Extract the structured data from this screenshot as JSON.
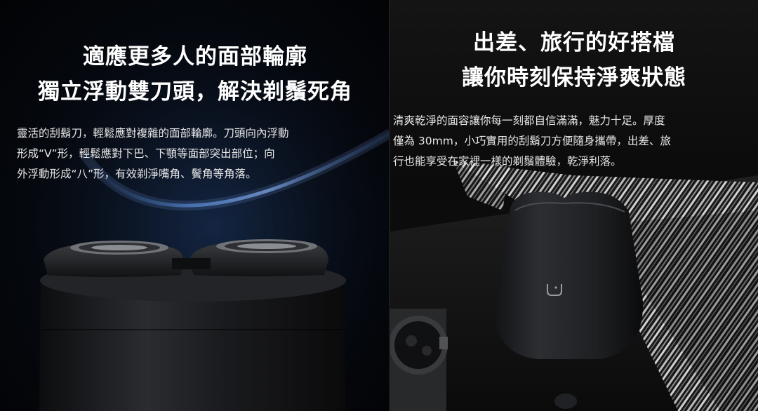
{
  "left": {
    "title_line1": "適應更多人的面部輪廓",
    "title_line2": "獨立浮動雙刀頭，解決剃鬚死角",
    "body_line1": "靈活的刮鬍刀，輕鬆應對複雜的面部輪廓。刀頭向內浮動",
    "body_line2": "形成“V”形，輕鬆應對下巴、下顎等面部突出部位；向",
    "body_line3": "外浮動形成“八”形，有效剃淨嘴角、鬢角等角落。"
  },
  "right": {
    "title_line1": "出差、旅行的好搭檔",
    "title_line2": "讓你時刻保持淨爽狀態",
    "body_line1": "清爽乾淨的面容讓你每一刻都自信滿滿，魅力十足。厚度",
    "body_line2": "僅為 30mm，小巧實用的刮鬍刀方便隨身攜帶，出差、旅",
    "body_line3": "行也能享受在家裡一樣的剃鬚體驗，乾淨利落。"
  },
  "colors": {
    "title": "#ffffff",
    "body": "#e8e8e8",
    "left_glow": "#3a6db5",
    "shaver": "#1a1b1d"
  }
}
